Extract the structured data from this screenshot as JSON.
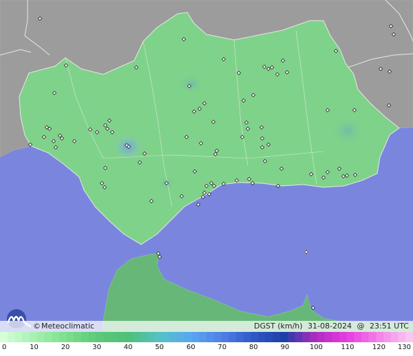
{
  "map": {
    "credit": "Meteoclimatic",
    "copyright_symbol": "©",
    "variable": "DGST (km/h)",
    "date": "31-08-2024",
    "at": "@",
    "time": "23:51 UTC"
  },
  "colors": {
    "sea": "#7a86dd",
    "land_outside": "#9c9c9c",
    "region_land": "#7fd28a",
    "africa_land": "#67b878",
    "border": "#e8e8e8"
  },
  "legend": {
    "ticks": [
      "0",
      "10",
      "20",
      "30",
      "40",
      "50",
      "60",
      "70",
      "80",
      "90",
      "100",
      "110",
      "120",
      "130"
    ],
    "stops": [
      "#d4ffd8",
      "#a6f0b0",
      "#7ddf8c",
      "#5cc97a",
      "#4fbf7a",
      "#54c2c6",
      "#5aa7f2",
      "#4f7fe6",
      "#2f58c8",
      "#1f3ea6",
      "#b02cc0",
      "#e73ce2",
      "#f282e8",
      "#f9c6f3"
    ]
  },
  "chart_data": {
    "type": "scatter",
    "title": "",
    "xlabel": "",
    "ylabel": "",
    "series": [
      {
        "values": []
      }
    ]
  }
}
